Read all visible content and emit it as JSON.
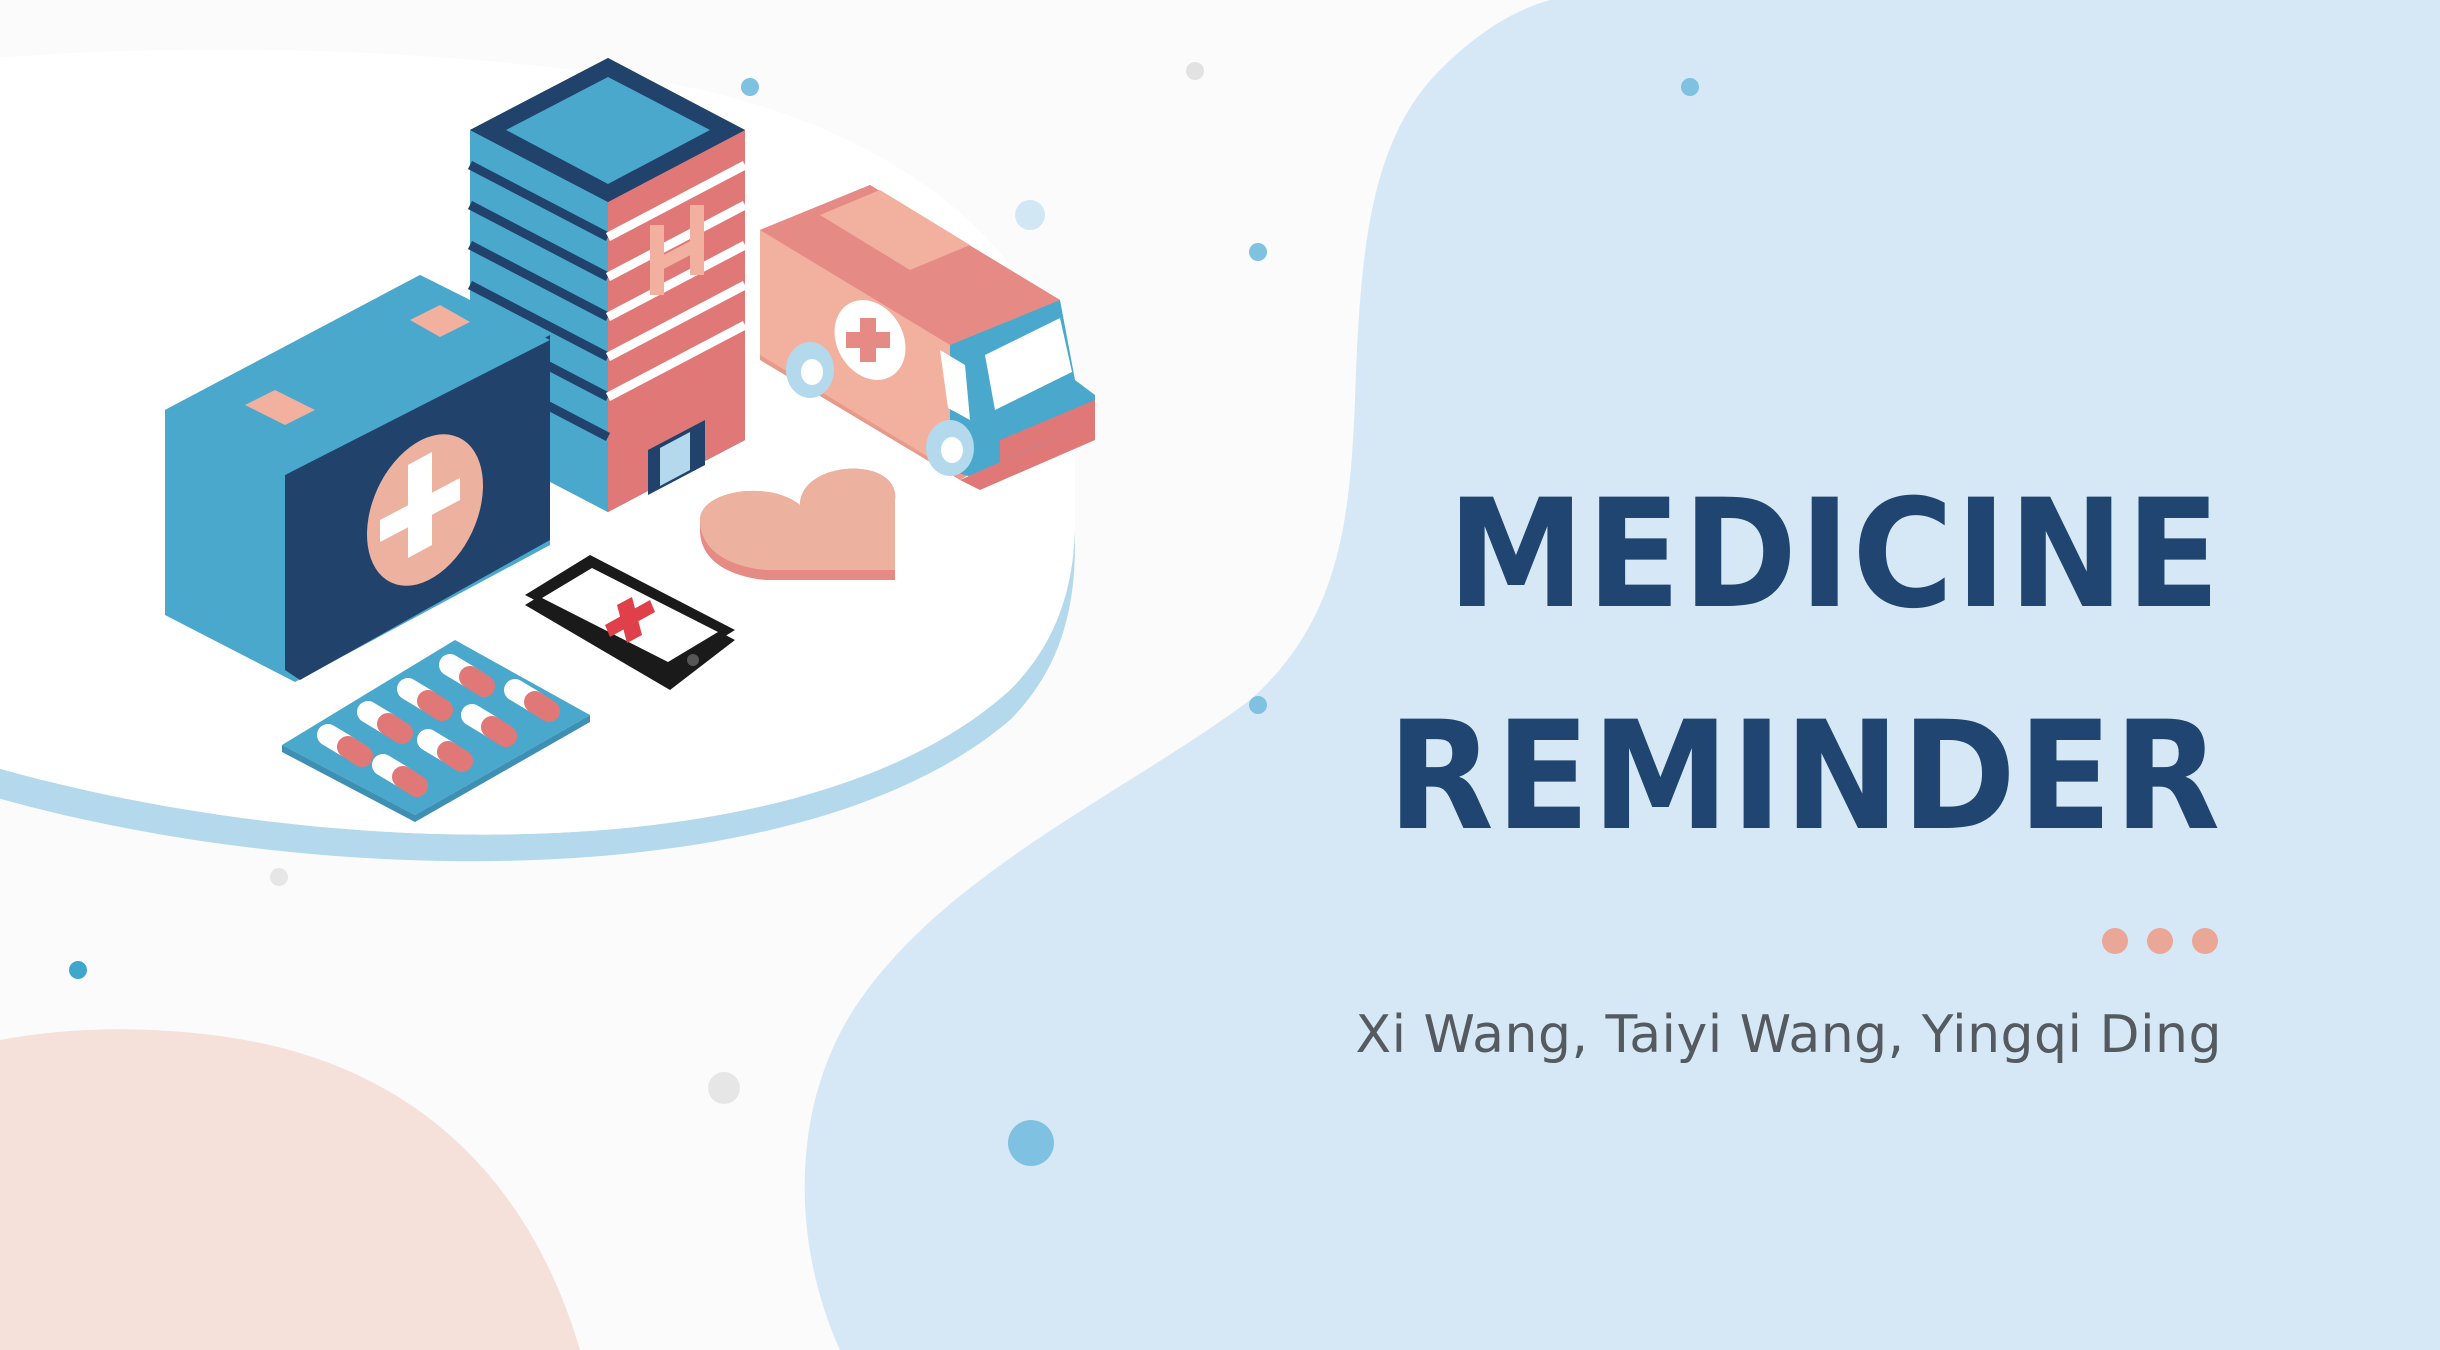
{
  "slide": {
    "title_line_1": "MEDICINE",
    "title_line_2": "REMINDER",
    "authors": "Xi Wang, Taiyi Wang, Yingqi Ding"
  },
  "colors": {
    "background": "#fbfbfb",
    "blue_blob": "#d6e8f5",
    "pink_blob": "#f6e0da",
    "title": "#1f4570",
    "authors": "#555a60",
    "accent_pink": "#eaa797",
    "accent_blue": "#4aa8cd",
    "navy": "#21426b"
  },
  "illustration": {
    "icons": [
      "medical-kit-icon",
      "hospital-building-icon",
      "ambulance-icon",
      "heart-icon",
      "smartphone-medical-icon",
      "pill-blister-icon"
    ]
  }
}
